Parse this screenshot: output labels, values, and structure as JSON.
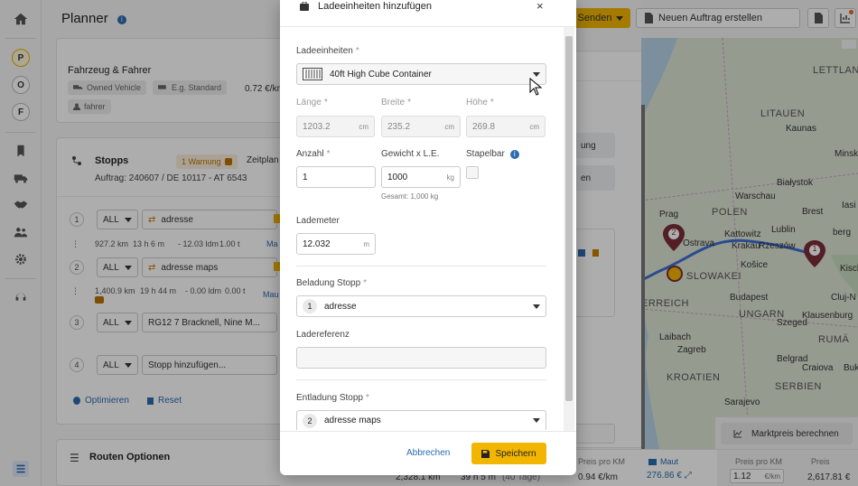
{
  "rail": {
    "circles": [
      "P",
      "O",
      "F"
    ]
  },
  "planner": {
    "title": "Planner",
    "top_actions": {
      "send_label": "Senden",
      "new_order_label": "Neuen Auftrag erstellen"
    },
    "vehicle": {
      "title": "Fahrzeug & Fahrer",
      "vehicle_pill": "Owned Vehicle",
      "standard_pill": "E.g. Standard",
      "rate": "0.72 €/km",
      "driver_pill": "fahrer"
    },
    "stops": {
      "title": "Stopps",
      "warning": "1 Warnung",
      "schedule": "Zeitplan",
      "order_ref": "Auftrag: 240607 / DE 10117 - AT 6543",
      "rows": [
        {
          "num": "1",
          "sel": "ALL",
          "addr": "adresse"
        },
        {
          "num": "2",
          "sel": "ALL",
          "addr": "adresse maps"
        },
        {
          "num": "3",
          "sel": "ALL",
          "addr": "RG12 7 Bracknell, Nine M..."
        },
        {
          "num": "4",
          "sel": "ALL",
          "addr": "Stopp hinzufügen..."
        }
      ],
      "leg1": {
        "km": "927.2 km",
        "time": "13 h 6 m",
        "ldm": "- 12.03 ldm",
        "t": "1.00 t",
        "tag": "Ma"
      },
      "leg2": {
        "km": "1,400.9 km",
        "time": "19 h 44 m",
        "ldm": "- 0.00 ldm",
        "t": "0.00 t",
        "tag": "Mau"
      },
      "optimize": "Optimieren",
      "reset": "Reset"
    },
    "route_options": "Routen Optionen",
    "side_buttons": [
      "ung",
      "en"
    ]
  },
  "map": {
    "labels": {
      "lettland": "LETTLAND",
      "litauen": "LITAUEN",
      "kaunas": "Kaunas",
      "minsk": "Minsk",
      "bialystok": "Białystok",
      "warschau": "Warschau",
      "polen": "POLEN",
      "brest": "Brest",
      "lublin": "Lublin",
      "rzeszow": "Rzeszów",
      "krakau": "Krakau",
      "kattowitz": "Kattowitz",
      "ostrava": "Ostrava",
      "prag": "Prag",
      "kosice": "Košice",
      "slowakei": "SLOWAKEI",
      "budapest": "Budapest",
      "ungarn": "UNGARN",
      "erreich": "ERREICH",
      "szeged": "Szeged",
      "cluj": "Cluj-N",
      "laibach": "Laibach",
      "zagreb": "Zagreb",
      "kroatien": "KROATIEN",
      "belgrad": "Belgrad",
      "serbien": "SERBIEN",
      "sarajevo": "Sarajevo",
      "iasi": "Iasi",
      "berg": "berg",
      "kisch": "Kisch",
      "klausenburg": "Klausenburg",
      "rumae": "RUMÄ",
      "craiova": "Craiova",
      "bukarest": "Buk"
    },
    "marker1": "1",
    "marker2": "2",
    "price_button": "Marktpreis berechnen"
  },
  "bottom_bar": {
    "km": "2,328.1 km",
    "time": "39 h 5 m",
    "days": "(40 Tage)",
    "price_per_km_label": "Preis pro KM",
    "price_per_km_value": "0.94 €/km",
    "toll_label": "Maut",
    "toll_value": "276.86 €",
    "price_label": "Preis pro KM",
    "price_input": "1.12",
    "price_unit": "€/km",
    "total_label": "Preis",
    "total_value": "2,617.81 €"
  },
  "modal": {
    "title": "Ladeeinheiten hinzufügen",
    "loading_units_label": "Ladeeinheiten",
    "loading_unit_value": "40ft High Cube Container",
    "length_label": "Länge",
    "length_value": "1203.2",
    "width_label": "Breite",
    "width_value": "235.2",
    "height_label": "Höhe",
    "height_value": "269.8",
    "unit_cm": "cm",
    "count_label": "Anzahl",
    "count_value": "1",
    "weight_label": "Gewicht x L.E.",
    "weight_value": "1000",
    "weight_unit": "kg",
    "weight_total": "Gesamt: 1,000 kg",
    "stackable_label": "Stapelbar",
    "loading_meter_label": "Lademeter",
    "loading_meter_value": "12.032",
    "loading_meter_unit": "m",
    "pickup_label": "Beladung Stopp",
    "pickup_num": "1",
    "pickup_value": "adresse",
    "reference_label": "Ladereferenz",
    "reference_value": "",
    "delivery_label": "Entladung Stopp",
    "delivery_num": "2",
    "delivery_value": "adresse maps",
    "required_mark": "*",
    "cancel_label": "Abbrechen",
    "save_label": "Speichern"
  },
  "colors": {
    "accent": "#f2b600",
    "primary_link": "#2b6cb0",
    "marker_dark": "#7a2e3a",
    "route": "#3f6fd6"
  }
}
